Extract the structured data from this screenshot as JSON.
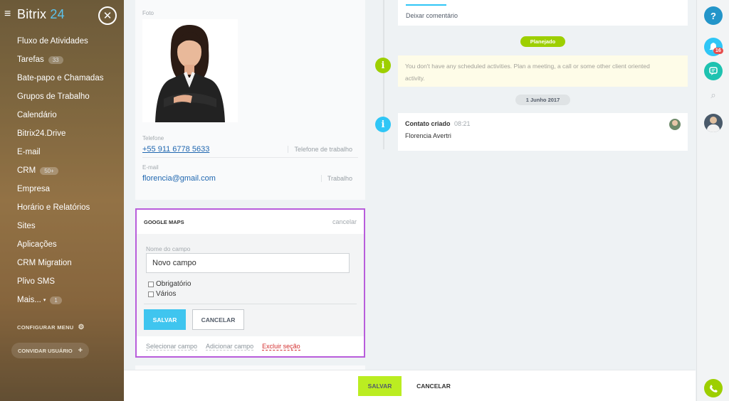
{
  "sidebar": {
    "logo_main": "Bitrix",
    "logo_num": "24",
    "items": [
      {
        "label": "Fluxo de Atividades",
        "count": ""
      },
      {
        "label": "Tarefas",
        "count": "33"
      },
      {
        "label": "Bate-papo e Chamadas",
        "count": ""
      },
      {
        "label": "Grupos de Trabalho",
        "count": ""
      },
      {
        "label": "Calendário",
        "count": ""
      },
      {
        "label": "Bitrix24.Drive",
        "count": ""
      },
      {
        "label": "E-mail",
        "count": ""
      },
      {
        "label": "CRM",
        "count": "50+"
      },
      {
        "label": "Empresa",
        "count": ""
      },
      {
        "label": "Horário e Relatórios",
        "count": ""
      },
      {
        "label": "Sites",
        "count": ""
      },
      {
        "label": "Aplicações",
        "count": ""
      },
      {
        "label": "CRM Migration",
        "count": ""
      },
      {
        "label": "Plivo SMS",
        "count": ""
      },
      {
        "label": "Mais...",
        "count": "1"
      }
    ],
    "config_label": "CONFIGURAR MENU",
    "invite_label": "CONVIDAR USUÁRIO"
  },
  "contact": {
    "photo_label": "Foto",
    "phone_label": "Telefone",
    "phone_value": "+55 911 6778 5633",
    "phone_type": "Telefone de trabalho",
    "email_label": "E-mail",
    "email_value": "florencia@gmail.com",
    "email_type": "Trabalho"
  },
  "gmaps": {
    "title": "GOOGLE MAPS",
    "cancel_link": "cancelar",
    "field_name_label": "Nome do campo",
    "field_name_value": "Novo campo",
    "required_label": "Obrigatório",
    "multiple_label": "Vários",
    "save_label": "SALVAR",
    "cancel_label": "CANCELAR",
    "select_field": "Selecionar campo",
    "add_field": "Adicionar campo",
    "delete_section": "Excluir seção"
  },
  "bottom": {
    "save_label": "SALVAR",
    "cancel_label": "CANCELAR"
  },
  "timeline": {
    "leave_comment": "Deixar comentário",
    "planned_badge": "Planejado",
    "no_activities": "You don't have any scheduled activities. Plan a meeting, a call or some other client oriented activity.",
    "date_badge": "1 Junho 2017",
    "event_title": "Contato criado",
    "event_time": "08:21",
    "event_person": "Florencia Avertri"
  },
  "rightbar": {
    "help": "?",
    "notif_count": "16"
  },
  "colors": {
    "accent": "#3fc5ef",
    "save_green": "#bbed21",
    "timeline_green": "#9dcf00",
    "highlight": "#b85ddb"
  }
}
